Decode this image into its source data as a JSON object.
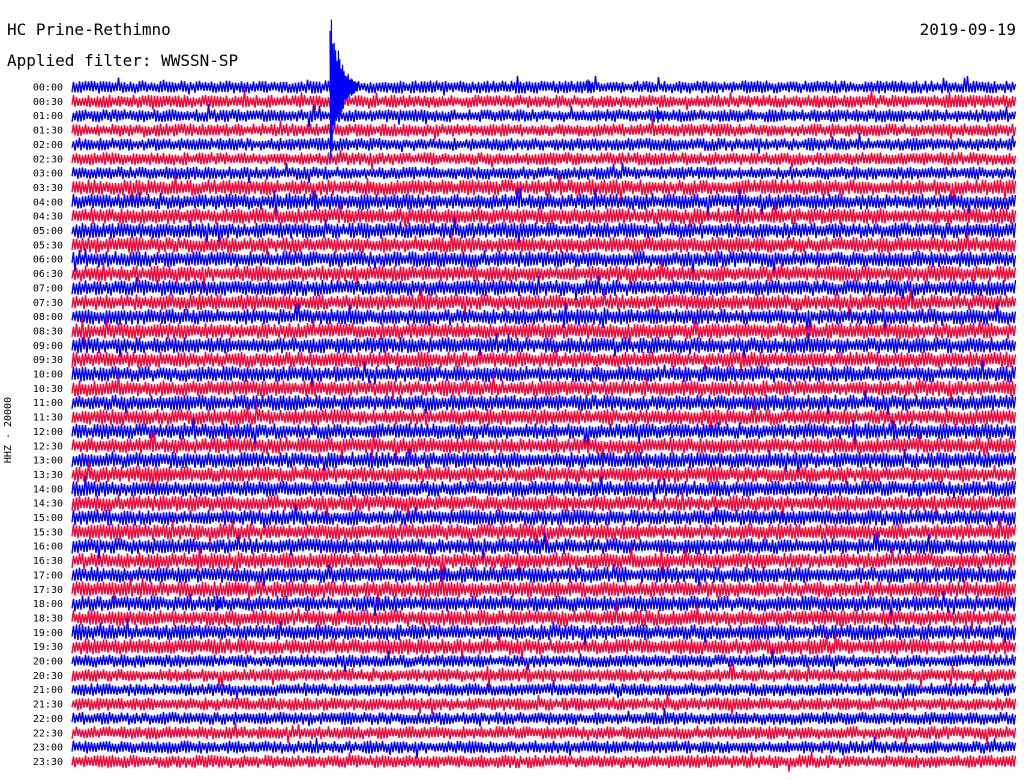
{
  "header": {
    "station": "HC Prine-Rethimno",
    "filter": "Applied filter: WWSSN-SP",
    "date": "2019-09-19",
    "channel": "HHZ - 20000"
  },
  "colors": {
    "trace_a": "#0000ff",
    "trace_b": "#ff0033"
  },
  "chart_data": {
    "type": "line",
    "title": "HC Prine-Rethimno",
    "subtitle": "Applied filter: WWSSN-SP",
    "ylabel": "HHZ - 20000",
    "row_labels": [
      "00:00",
      "00:30",
      "01:00",
      "01:30",
      "02:00",
      "02:30",
      "03:00",
      "03:30",
      "04:00",
      "04:30",
      "05:00",
      "05:30",
      "06:00",
      "06:30",
      "07:00",
      "07:30",
      "08:00",
      "08:30",
      "09:00",
      "09:30",
      "10:00",
      "10:30",
      "11:00",
      "11:30",
      "12:00",
      "12:30",
      "13:00",
      "13:30",
      "14:00",
      "14:30",
      "15:00",
      "15:30",
      "16:00",
      "16:30",
      "17:00",
      "17:30",
      "18:00",
      "18:30",
      "19:00",
      "19:30",
      "20:00",
      "20:30",
      "21:00",
      "21:30",
      "22:00",
      "22:30",
      "23:00",
      "23:30"
    ],
    "row_minutes": 15,
    "series": [
      {
        "color": "#0000ff"
      },
      {
        "color": "#ff0033"
      }
    ],
    "events": [
      {
        "row": "00:00",
        "minute": 4.1,
        "amplitude": 6.0
      },
      {
        "row": "00:00",
        "minute": 8.2,
        "amplitude": 0.8
      },
      {
        "row": "01:00",
        "minute": 9.3,
        "amplitude": 0.9
      },
      {
        "row": "17:30",
        "minute": 2.6,
        "amplitude": 0.9
      },
      {
        "row": "18:00",
        "minute": 2.3,
        "amplitude": 0.8
      }
    ]
  }
}
